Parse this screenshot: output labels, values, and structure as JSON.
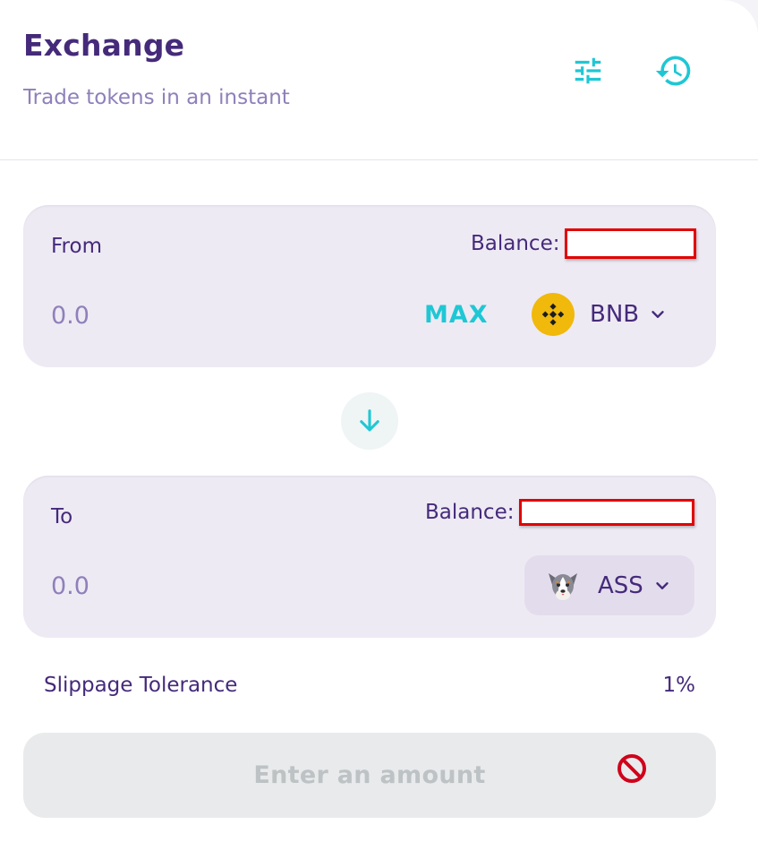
{
  "header": {
    "title": "Exchange",
    "subtitle": "Trade tokens in an instant",
    "settings_icon": "sliders-icon",
    "history_icon": "history-icon"
  },
  "from_panel": {
    "label": "From",
    "balance_label": "Balance:",
    "amount_placeholder": "0.0",
    "max_label": "MAX",
    "token": {
      "symbol": "BNB",
      "icon": "bnb-logo-icon"
    }
  },
  "to_panel": {
    "label": "To",
    "balance_label": "Balance:",
    "amount_placeholder": "0.0",
    "token": {
      "symbol": "ASS",
      "icon": "dog-logo-icon"
    }
  },
  "slippage": {
    "label": "Slippage Tolerance",
    "value": "1%"
  },
  "submit": {
    "label": "Enter an amount",
    "icon": "blocked-icon"
  },
  "colors": {
    "primary_text": "#452a7a",
    "secondary_text": "#8f80ba",
    "accent": "#1fc7d4",
    "panel_bg": "#eeeaf4",
    "disabled_bg": "#e9eaeb",
    "disabled_text": "#bdc2c4",
    "redaction": "#e20000",
    "bnb_yellow": "#f0b90b"
  }
}
